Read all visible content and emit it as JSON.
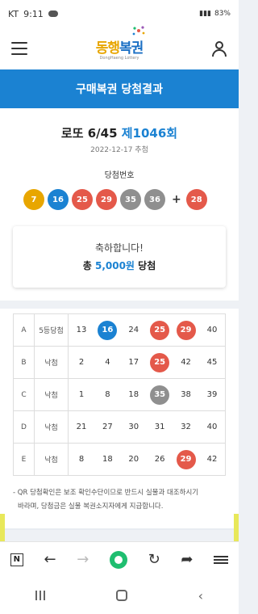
{
  "status": {
    "carrier": "KT",
    "time": "9:11",
    "battery": "83%"
  },
  "app": {
    "logo_text_a": "동행",
    "logo_text_b": "복권",
    "logo_sub": "DongHaeng Lottery"
  },
  "title_bar": {
    "title": "구매복권 당첨결과"
  },
  "draw": {
    "game": "로또 6/45",
    "round": "제1046회",
    "date": "2022-12-17 추첨",
    "numbers_label": "당첨번호",
    "numbers": [
      {
        "n": "7",
        "color": "#e8a600"
      },
      {
        "n": "16",
        "color": "#1b82d2"
      },
      {
        "n": "25",
        "color": "#e4594a"
      },
      {
        "n": "29",
        "color": "#e4594a"
      },
      {
        "n": "35",
        "color": "#8f8f8f"
      },
      {
        "n": "36",
        "color": "#8f8f8f"
      }
    ],
    "plus": "+",
    "bonus": {
      "n": "28",
      "color": "#e4594a"
    }
  },
  "prize": {
    "congrats": "축하합니다!",
    "prefix": "총",
    "amount": "5,000원",
    "suffix": "당첨"
  },
  "ticket": {
    "rows": [
      {
        "game": "A",
        "result": "5등당첨",
        "nums": [
          {
            "n": "13",
            "hit": false
          },
          {
            "n": "16",
            "hit": true,
            "color": "#1b82d2"
          },
          {
            "n": "24",
            "hit": false
          },
          {
            "n": "25",
            "hit": true,
            "color": "#e4594a"
          },
          {
            "n": "29",
            "hit": true,
            "color": "#e4594a"
          },
          {
            "n": "40",
            "hit": false
          }
        ]
      },
      {
        "game": "B",
        "result": "낙첨",
        "nums": [
          {
            "n": "2",
            "hit": false
          },
          {
            "n": "4",
            "hit": false
          },
          {
            "n": "17",
            "hit": false
          },
          {
            "n": "25",
            "hit": true,
            "color": "#e4594a"
          },
          {
            "n": "42",
            "hit": false
          },
          {
            "n": "45",
            "hit": false
          }
        ]
      },
      {
        "game": "C",
        "result": "낙첨",
        "nums": [
          {
            "n": "1",
            "hit": false
          },
          {
            "n": "8",
            "hit": false
          },
          {
            "n": "18",
            "hit": false
          },
          {
            "n": "35",
            "hit": true,
            "color": "#8f8f8f"
          },
          {
            "n": "38",
            "hit": false
          },
          {
            "n": "39",
            "hit": false
          }
        ]
      },
      {
        "game": "D",
        "result": "낙첨",
        "nums": [
          {
            "n": "21",
            "hit": false
          },
          {
            "n": "27",
            "hit": false
          },
          {
            "n": "30",
            "hit": false
          },
          {
            "n": "31",
            "hit": false
          },
          {
            "n": "32",
            "hit": false
          },
          {
            "n": "40",
            "hit": false
          }
        ]
      },
      {
        "game": "E",
        "result": "낙첨",
        "nums": [
          {
            "n": "8",
            "hit": false
          },
          {
            "n": "18",
            "hit": false
          },
          {
            "n": "20",
            "hit": false
          },
          {
            "n": "26",
            "hit": false
          },
          {
            "n": "29",
            "hit": true,
            "color": "#e4594a"
          },
          {
            "n": "42",
            "hit": false
          }
        ]
      }
    ]
  },
  "notice": {
    "line1": "- QR 당첨확인은 보조 확인수단이므로 반드시 실물과 대조하시기",
    "line2": "  바라며, 당첨금은 실물 복권소지자에게 지급합니다."
  },
  "browser": {
    "tab_label": "N"
  },
  "icons": {
    "menu": "hamburger-icon",
    "account": "person-icon",
    "back": "arrow-left-icon",
    "forward": "arrow-right-icon",
    "home": "green-circle-icon",
    "reload": "reload-icon",
    "share": "share-icon",
    "more": "menu-icon"
  }
}
